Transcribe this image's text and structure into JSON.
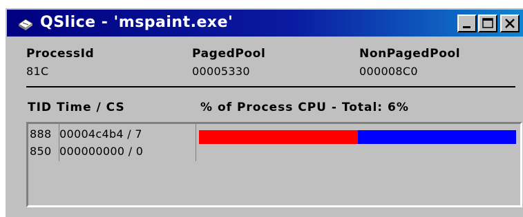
{
  "window": {
    "title": "QSlice - 'mspaint.exe'",
    "icon": "qslice-app-icon",
    "controls": [
      "minimize",
      "maximize",
      "close"
    ]
  },
  "process_info": {
    "columns": [
      {
        "label": "ProcessId",
        "value": "81C"
      },
      {
        "label": "PagedPool",
        "value": "00005330"
      },
      {
        "label": "NonPagedPool",
        "value": "000008C0"
      }
    ]
  },
  "threads": {
    "header_left": "TID Time  / CS",
    "header_right": "% of Process CPU - Total: 6%",
    "rows": [
      {
        "tid": "888",
        "time_cs": "00004c4b4 / 7",
        "cpu_share": {
          "red": 0.5,
          "blue": 0.5
        }
      },
      {
        "tid": "850",
        "time_cs": "000000000 / 0"
      }
    ]
  },
  "colors": {
    "bar_red": "#ff0000",
    "bar_blue": "#0000ff",
    "title_bar": "#000080",
    "face": "#c0c0c0"
  }
}
